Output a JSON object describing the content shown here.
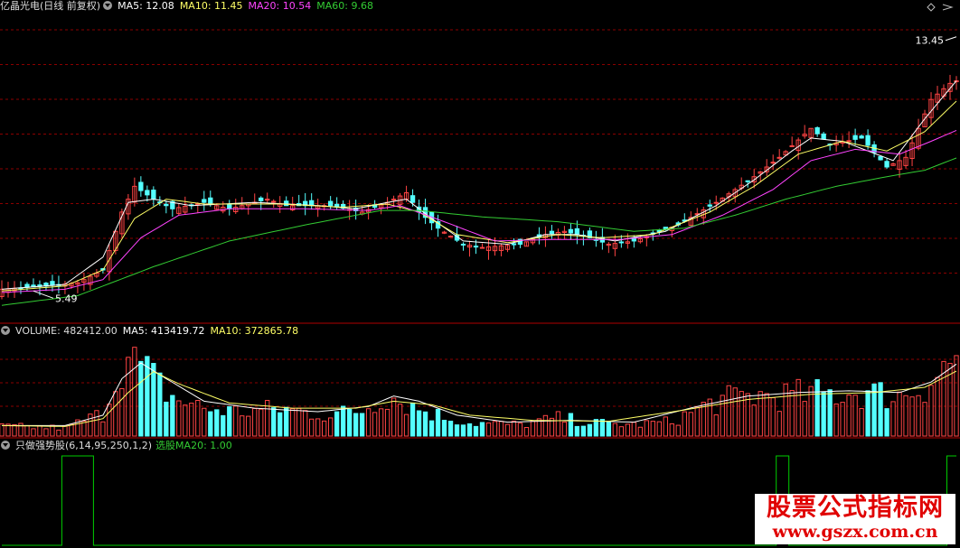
{
  "price_header": {
    "title": "亿晶光电(日线 前复权)",
    "ma5": "MA5: 12.08",
    "ma10": "MA10: 11.45",
    "ma20": "MA20: 10.54",
    "ma60": "MA60: 9.68"
  },
  "volume_header": {
    "title": "VOLUME: 482412.00",
    "ma5": "MA5: 413419.72",
    "ma10": "MA10: 372865.78"
  },
  "indicator_header": {
    "title": "只做强势股(6,14,95,250,1,2)",
    "value": "选股MA20: 1.00"
  },
  "watermark": {
    "line1": "股票公式指标网",
    "line2": "www.gszx.com.cn"
  },
  "colors": {
    "up": "#ff4444",
    "down": "#54ffff",
    "ma5": "#ffffff",
    "ma10": "#ffff66",
    "ma20": "#ff44ff",
    "ma60": "#33cc33",
    "grid": "#8b0000",
    "signal": "#00cc00"
  },
  "chart_data": [
    {
      "type": "candlestick",
      "annotations": {
        "high_label": "13.45",
        "low_label": "5.49"
      },
      "ylim": [
        4.6,
        14.2
      ],
      "close_points": [
        [
          0,
          5.6
        ],
        [
          7,
          5.7
        ],
        [
          12,
          5.8
        ],
        [
          16,
          6.2
        ],
        [
          19,
          8.0
        ],
        [
          21,
          8.8
        ],
        [
          24,
          8.4
        ],
        [
          27,
          8.1
        ],
        [
          32,
          8.3
        ],
        [
          36,
          8.1
        ],
        [
          42,
          8.4
        ],
        [
          45,
          8.2
        ],
        [
          52,
          8.2
        ],
        [
          57,
          8.0
        ],
        [
          61,
          8.3
        ],
        [
          64,
          8.6
        ],
        [
          66,
          8.0
        ],
        [
          69,
          7.5
        ],
        [
          73,
          7.0
        ],
        [
          76,
          6.9
        ],
        [
          82,
          7.0
        ],
        [
          86,
          7.3
        ],
        [
          89,
          7.4
        ],
        [
          93,
          7.2
        ],
        [
          96,
          7.0
        ],
        [
          100,
          7.1
        ],
        [
          107,
          7.6
        ],
        [
          113,
          8.3
        ],
        [
          119,
          9.1
        ],
        [
          123,
          9.7
        ],
        [
          128,
          10.6
        ],
        [
          131,
          10.1
        ],
        [
          136,
          10.3
        ],
        [
          140,
          9.4
        ],
        [
          143,
          9.7
        ],
        [
          147,
          11.5
        ],
        [
          150,
          12.0
        ],
        [
          151,
          12.08
        ]
      ],
      "ma_points": {
        "ma5": [
          [
            0,
            5.6
          ],
          [
            10,
            5.75
          ],
          [
            16,
            6.6
          ],
          [
            20,
            8.3
          ],
          [
            24,
            8.4
          ],
          [
            30,
            8.2
          ],
          [
            40,
            8.3
          ],
          [
            50,
            8.2
          ],
          [
            56,
            8.1
          ],
          [
            61,
            8.3
          ],
          [
            64,
            8.4
          ],
          [
            68,
            7.8
          ],
          [
            73,
            7.1
          ],
          [
            80,
            7.0
          ],
          [
            86,
            7.3
          ],
          [
            91,
            7.3
          ],
          [
            97,
            7.1
          ],
          [
            105,
            7.4
          ],
          [
            113,
            8.2
          ],
          [
            119,
            9.0
          ],
          [
            125,
            9.9
          ],
          [
            128,
            10.3
          ],
          [
            133,
            10.2
          ],
          [
            137,
            9.9
          ],
          [
            141,
            9.6
          ],
          [
            146,
            10.9
          ],
          [
            151,
            12.08
          ]
        ],
        "ma10": [
          [
            0,
            5.55
          ],
          [
            10,
            5.7
          ],
          [
            16,
            6.2
          ],
          [
            21,
            7.8
          ],
          [
            26,
            8.4
          ],
          [
            32,
            8.25
          ],
          [
            44,
            8.25
          ],
          [
            54,
            8.15
          ],
          [
            61,
            8.25
          ],
          [
            66,
            8.0
          ],
          [
            72,
            7.3
          ],
          [
            80,
            7.05
          ],
          [
            88,
            7.3
          ],
          [
            95,
            7.2
          ],
          [
            103,
            7.3
          ],
          [
            112,
            8.0
          ],
          [
            119,
            8.8
          ],
          [
            126,
            9.8
          ],
          [
            133,
            10.2
          ],
          [
            140,
            9.9
          ],
          [
            146,
            10.5
          ],
          [
            151,
            11.45
          ]
        ],
        "ma20": [
          [
            0,
            5.5
          ],
          [
            10,
            5.6
          ],
          [
            16,
            5.9
          ],
          [
            22,
            7.2
          ],
          [
            28,
            7.9
          ],
          [
            36,
            8.1
          ],
          [
            48,
            8.1
          ],
          [
            58,
            8.05
          ],
          [
            63,
            8.2
          ],
          [
            70,
            7.7
          ],
          [
            78,
            7.1
          ],
          [
            88,
            7.15
          ],
          [
            98,
            7.15
          ],
          [
            106,
            7.3
          ],
          [
            114,
            7.9
          ],
          [
            122,
            8.7
          ],
          [
            128,
            9.6
          ],
          [
            135,
            9.95
          ],
          [
            142,
            9.8
          ],
          [
            147,
            10.2
          ],
          [
            151,
            10.54
          ]
        ],
        "ma60": [
          [
            0,
            5.1
          ],
          [
            12,
            5.4
          ],
          [
            24,
            6.3
          ],
          [
            36,
            7.1
          ],
          [
            48,
            7.6
          ],
          [
            60,
            8.05
          ],
          [
            66,
            8.05
          ],
          [
            76,
            7.85
          ],
          [
            88,
            7.7
          ],
          [
            100,
            7.4
          ],
          [
            108,
            7.5
          ],
          [
            116,
            7.9
          ],
          [
            124,
            8.4
          ],
          [
            132,
            8.8
          ],
          [
            140,
            9.1
          ],
          [
            146,
            9.3
          ],
          [
            151,
            9.68
          ]
        ]
      }
    },
    {
      "type": "bar",
      "ylim": [
        0,
        560000
      ],
      "volume_points": [
        [
          0,
          60000
        ],
        [
          10,
          50000
        ],
        [
          16,
          140000
        ],
        [
          19,
          480000
        ],
        [
          22,
          420000
        ],
        [
          27,
          240000
        ],
        [
          32,
          170000
        ],
        [
          38,
          150000
        ],
        [
          44,
          170000
        ],
        [
          52,
          130000
        ],
        [
          57,
          160000
        ],
        [
          61,
          260000
        ],
        [
          64,
          200000
        ],
        [
          68,
          140000
        ],
        [
          74,
          80000
        ],
        [
          82,
          70000
        ],
        [
          88,
          110000
        ],
        [
          94,
          80000
        ],
        [
          100,
          70000
        ],
        [
          106,
          90000
        ],
        [
          112,
          200000
        ],
        [
          118,
          250000
        ],
        [
          124,
          250000
        ],
        [
          130,
          260000
        ],
        [
          136,
          270000
        ],
        [
          142,
          250000
        ],
        [
          146,
          320000
        ],
        [
          151,
          482412
        ]
      ],
      "ma5_points": [
        [
          0,
          60000
        ],
        [
          10,
          60000
        ],
        [
          16,
          120000
        ],
        [
          19,
          330000
        ],
        [
          22,
          420000
        ],
        [
          26,
          330000
        ],
        [
          32,
          200000
        ],
        [
          40,
          160000
        ],
        [
          50,
          140000
        ],
        [
          58,
          170000
        ],
        [
          62,
          230000
        ],
        [
          66,
          200000
        ],
        [
          72,
          120000
        ],
        [
          80,
          80000
        ],
        [
          90,
          90000
        ],
        [
          100,
          80000
        ],
        [
          110,
          170000
        ],
        [
          118,
          230000
        ],
        [
          126,
          250000
        ],
        [
          134,
          260000
        ],
        [
          142,
          250000
        ],
        [
          147,
          310000
        ],
        [
          151,
          413420
        ]
      ],
      "ma10_points": [
        [
          0,
          60000
        ],
        [
          10,
          55000
        ],
        [
          16,
          100000
        ],
        [
          20,
          250000
        ],
        [
          24,
          370000
        ],
        [
          28,
          300000
        ],
        [
          36,
          190000
        ],
        [
          46,
          160000
        ],
        [
          56,
          160000
        ],
        [
          62,
          200000
        ],
        [
          68,
          180000
        ],
        [
          74,
          120000
        ],
        [
          84,
          90000
        ],
        [
          96,
          85000
        ],
        [
          108,
          150000
        ],
        [
          118,
          210000
        ],
        [
          128,
          240000
        ],
        [
          138,
          250000
        ],
        [
          146,
          280000
        ],
        [
          151,
          372866
        ]
      ]
    },
    {
      "type": "line",
      "series": [
        {
          "name": "选股MA20",
          "signal_ranges": [
            [
              10,
              14
            ],
            [
              123,
              124
            ],
            [
              150,
              151
            ]
          ]
        }
      ],
      "ylim": [
        0,
        1
      ]
    }
  ]
}
